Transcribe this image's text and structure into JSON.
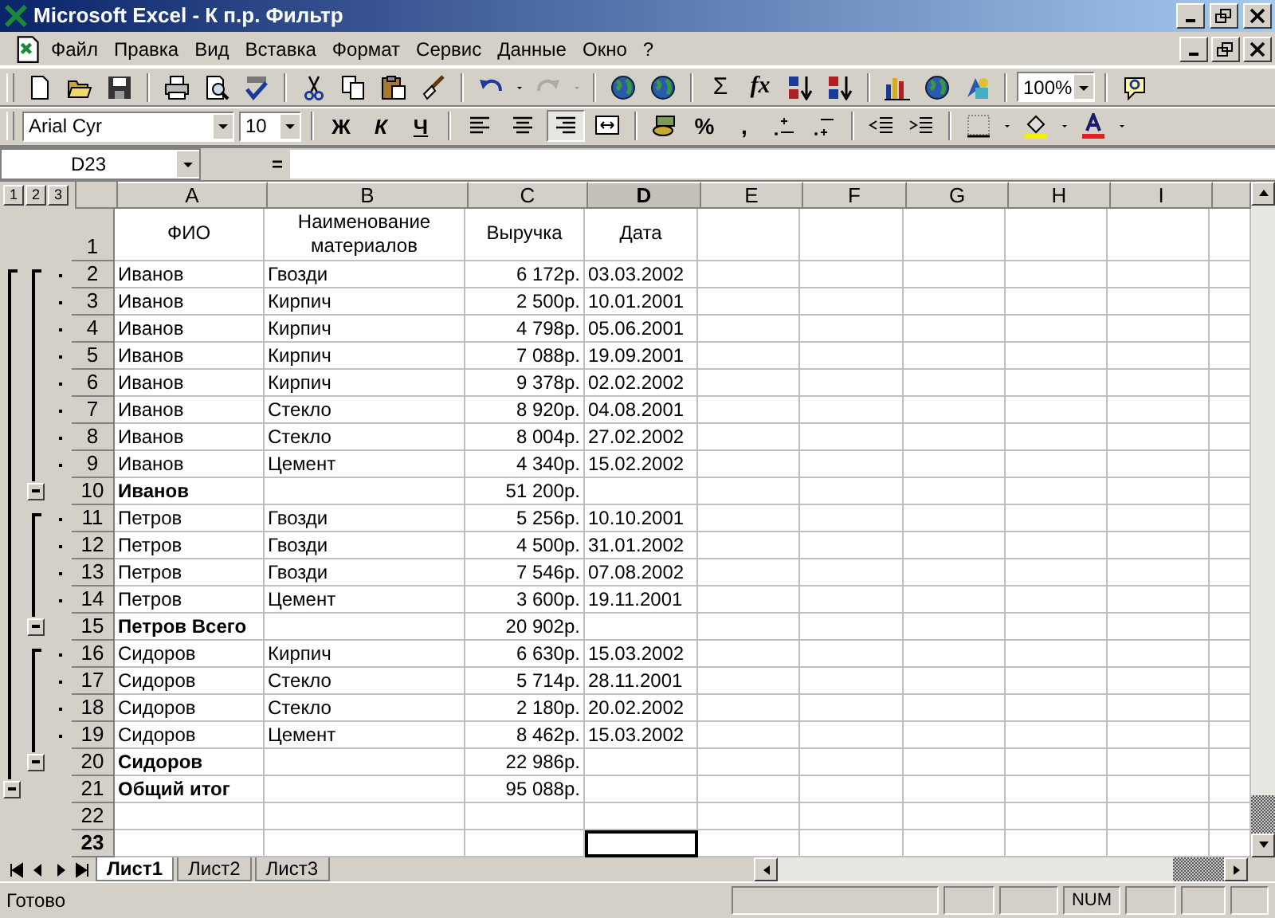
{
  "window": {
    "title": "Microsoft Excel - К п.р. Фильтр"
  },
  "menu": [
    "Файл",
    "Правка",
    "Вид",
    "Вставка",
    "Формат",
    "Сервис",
    "Данные",
    "Окно",
    "?"
  ],
  "standard_toolbar": {
    "sum": "Σ",
    "function": "fx",
    "zoom": "100%"
  },
  "format_toolbar": {
    "font": "Arial Cyr",
    "size": "10",
    "style_buttons": [
      "Ж",
      "К",
      "Ч"
    ],
    "align_buttons": [
      {
        "selected": false
      },
      {
        "selected": false
      },
      {
        "selected": true
      }
    ],
    "percent": "%",
    "comma": ","
  },
  "formula_bar": {
    "name_box": "D23",
    "equals": "="
  },
  "outline_levels": [
    "1",
    "2",
    "3"
  ],
  "columns": [
    {
      "label": "A",
      "selected": false
    },
    {
      "label": "B",
      "selected": false
    },
    {
      "label": "C",
      "selected": false
    },
    {
      "label": "D",
      "selected": true
    },
    {
      "label": "E",
      "selected": false
    },
    {
      "label": "F",
      "selected": false
    },
    {
      "label": "G",
      "selected": false
    },
    {
      "label": "H",
      "selected": false
    },
    {
      "label": "I",
      "selected": false
    }
  ],
  "rows": [
    {
      "num": "1",
      "kind": "header",
      "selected": false,
      "cells": {
        "A": "ФИО",
        "B": "Наименование материалов",
        "C": "Выручка",
        "D": "Дата"
      }
    },
    {
      "num": "2",
      "kind": "detail",
      "selected": false,
      "cells": {
        "A": "Иванов",
        "B": "Гвозди",
        "C": "6 172р.",
        "D": "03.03.2002"
      }
    },
    {
      "num": "3",
      "kind": "detail",
      "selected": false,
      "cells": {
        "A": "Иванов",
        "B": "Кирпич",
        "C": "2 500р.",
        "D": "10.01.2001"
      }
    },
    {
      "num": "4",
      "kind": "detail",
      "selected": false,
      "cells": {
        "A": "Иванов",
        "B": "Кирпич",
        "C": "4 798р.",
        "D": "05.06.2001"
      }
    },
    {
      "num": "5",
      "kind": "detail",
      "selected": false,
      "cells": {
        "A": "Иванов",
        "B": "Кирпич",
        "C": "7 088р.",
        "D": "19.09.2001"
      }
    },
    {
      "num": "6",
      "kind": "detail",
      "selected": false,
      "cells": {
        "A": "Иванов",
        "B": "Кирпич",
        "C": "9 378р.",
        "D": "02.02.2002"
      }
    },
    {
      "num": "7",
      "kind": "detail",
      "selected": false,
      "cells": {
        "A": "Иванов",
        "B": "Стекло",
        "C": "8 920р.",
        "D": "04.08.2001"
      }
    },
    {
      "num": "8",
      "kind": "detail",
      "selected": false,
      "cells": {
        "A": "Иванов",
        "B": "Стекло",
        "C": "8 004р.",
        "D": "27.02.2002"
      }
    },
    {
      "num": "9",
      "kind": "detail",
      "selected": false,
      "cells": {
        "A": "Иванов",
        "B": "Цемент",
        "C": "4 340р.",
        "D": "15.02.2002"
      }
    },
    {
      "num": "10",
      "kind": "subtotal",
      "selected": false,
      "cells": {
        "A": "Иванов",
        "C": "51 200р."
      }
    },
    {
      "num": "11",
      "kind": "detail",
      "selected": false,
      "cells": {
        "A": "Петров",
        "B": "Гвозди",
        "C": "5 256р.",
        "D": "10.10.2001"
      }
    },
    {
      "num": "12",
      "kind": "detail",
      "selected": false,
      "cells": {
        "A": "Петров",
        "B": "Гвозди",
        "C": "4 500р.",
        "D": "31.01.2002"
      }
    },
    {
      "num": "13",
      "kind": "detail",
      "selected": false,
      "cells": {
        "A": "Петров",
        "B": "Гвозди",
        "C": "7 546р.",
        "D": "07.08.2002"
      }
    },
    {
      "num": "14",
      "kind": "detail",
      "selected": false,
      "cells": {
        "A": "Петров",
        "B": "Цемент",
        "C": "3 600р.",
        "D": "19.11.2001"
      }
    },
    {
      "num": "15",
      "kind": "subtotal",
      "selected": false,
      "cells": {
        "A": "Петров Всего",
        "C": "20 902р."
      }
    },
    {
      "num": "16",
      "kind": "detail",
      "selected": false,
      "cells": {
        "A": "Сидоров",
        "B": "Кирпич",
        "C": "6 630р.",
        "D": "15.03.2002"
      }
    },
    {
      "num": "17",
      "kind": "detail",
      "selected": false,
      "cells": {
        "A": "Сидоров",
        "B": "Стекло",
        "C": "5 714р.",
        "D": "28.11.2001"
      }
    },
    {
      "num": "18",
      "kind": "detail",
      "selected": false,
      "cells": {
        "A": "Сидоров",
        "B": "Стекло",
        "C": "2 180р.",
        "D": "20.02.2002"
      }
    },
    {
      "num": "19",
      "kind": "detail",
      "selected": false,
      "cells": {
        "A": "Сидоров",
        "B": "Цемент",
        "C": "8 462р.",
        "D": "15.03.2002"
      }
    },
    {
      "num": "20",
      "kind": "subtotal",
      "selected": false,
      "cells": {
        "A": "Сидоров",
        "C": "22 986р."
      }
    },
    {
      "num": "21",
      "kind": "total",
      "selected": false,
      "cells": {
        "A": "Общий итог",
        "C": "95 088р."
      }
    },
    {
      "num": "22",
      "kind": "empty",
      "selected": false,
      "cells": {}
    },
    {
      "num": "23",
      "kind": "empty",
      "selected": true,
      "cells": {}
    }
  ],
  "sheet_tabs": [
    {
      "label": "Лист1",
      "selected": true
    },
    {
      "label": "Лист2",
      "selected": false
    },
    {
      "label": "Лист3",
      "selected": false
    }
  ],
  "status_bar": {
    "text": "Готово",
    "num": "NUM"
  }
}
